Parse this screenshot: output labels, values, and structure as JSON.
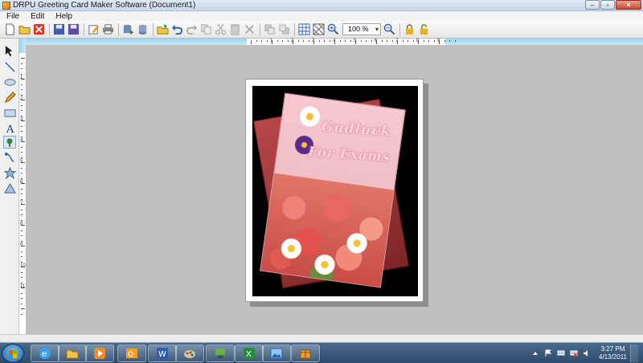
{
  "window": {
    "title": "DRPU Greeting Card Maker Software  (Document1)"
  },
  "menu": {
    "items": [
      "File",
      "Edit",
      "Help"
    ]
  },
  "toolbar": {
    "zoom_value": "100 %"
  },
  "ruler": {
    "h_labels": [
      "1",
      "2",
      "3",
      "4",
      "5",
      "6",
      "7",
      "8",
      "9"
    ],
    "v_labels": [
      "1",
      "2",
      "3",
      "4",
      "5",
      "6",
      "7",
      "8",
      "9",
      "10",
      "11"
    ]
  },
  "card": {
    "line1": "Gudluck",
    "line2": "For Exams"
  },
  "taskbar": {
    "time": "3:27 PM",
    "date": "4/13/2011"
  },
  "colors": {
    "ruler": "#9fd2ee",
    "canvas": "#c0c0c0",
    "taskbar": "#2c4a6c",
    "card_pink": "#f4c9cf"
  }
}
